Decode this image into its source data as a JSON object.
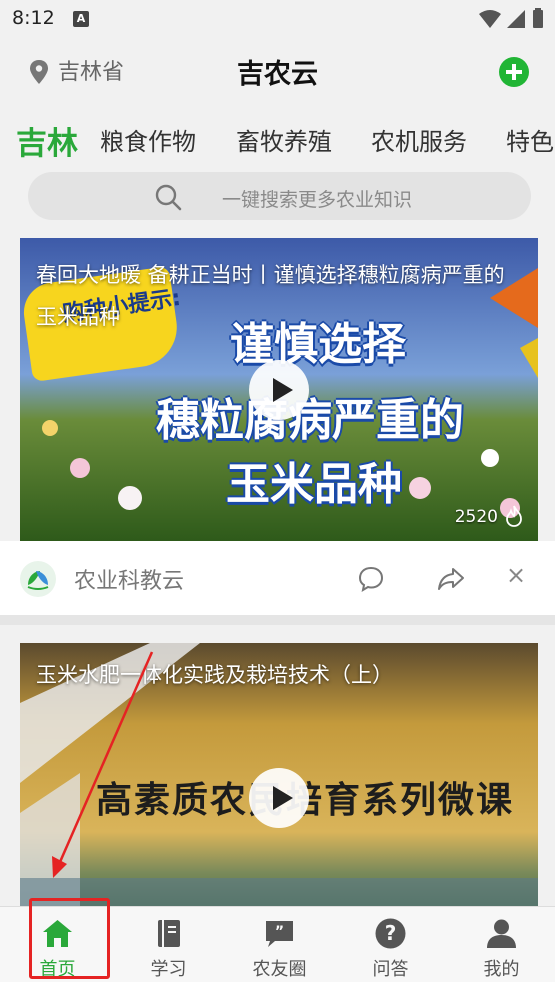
{
  "status_bar": {
    "time": "8:12",
    "notification_letter": "A"
  },
  "header": {
    "location": "吉林省",
    "title": "吉农云"
  },
  "tabs": [
    {
      "label": "吉林",
      "active": true
    },
    {
      "label": "粮食作物",
      "active": false
    },
    {
      "label": "畜牧养殖",
      "active": false
    },
    {
      "label": "农机服务",
      "active": false
    },
    {
      "label": "特色",
      "active": false
    }
  ],
  "search": {
    "placeholder": "一键搜索更多农业知识"
  },
  "feed": {
    "items": [
      {
        "title": "春回大地暖 备耕正当时丨谨慎选择穗粒腐病严重的玉米品种",
        "overlay_lines": [
          "谨慎选择",
          "穗粒腐病严重的",
          "玉米品种"
        ],
        "badge": "购种小提示:",
        "views": "2520",
        "source": "农业科教云"
      },
      {
        "title": "玉米水肥一体化实践及栽培技术（上）",
        "overlay_text": "高素质农民培育系列微课"
      }
    ]
  },
  "bottom_nav": [
    {
      "label": "首页",
      "icon": "home-icon",
      "active": true
    },
    {
      "label": "学习",
      "icon": "book-icon",
      "active": false
    },
    {
      "label": "农友圈",
      "icon": "chat-quote-icon",
      "active": false
    },
    {
      "label": "问答",
      "icon": "question-icon",
      "active": false
    },
    {
      "label": "我的",
      "icon": "user-icon",
      "active": false
    }
  ],
  "colors": {
    "accent": "#2aa83a",
    "add_button": "#21b535",
    "annotation": "#e52323"
  }
}
